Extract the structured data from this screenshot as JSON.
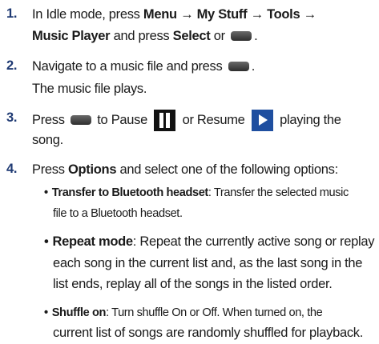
{
  "step1": {
    "number": "1.",
    "text_a": "In Idle mode, press ",
    "menu": "Menu",
    "arrow1": " → ",
    "my_stuff": "My Stuff",
    "arrow2": " → ",
    "tools": "Tools",
    "arrow3": " →",
    "music_player": "Music Player",
    "text_b": " and press ",
    "select": "Select",
    "text_c": " or ",
    "text_d": "."
  },
  "step2": {
    "number": "2.",
    "text_a": "Navigate to a music file and press ",
    "text_b": ".",
    "result": "The music file plays."
  },
  "step3": {
    "number": "3.",
    "press": "Press ",
    "to_pause": " to Pause ",
    "or_resume": " or Resume ",
    "playing": " playing the",
    "song": "song."
  },
  "step4": {
    "number": "4.",
    "press": "Press ",
    "options": "Options",
    "rest": " and select one of the following options:",
    "bullets": [
      {
        "term": "Transfer to Bluetooth headset",
        "lines": [
          ": Transfer the selected music",
          "file to a Bluetooth headset."
        ]
      },
      {
        "term": "Repeat mode",
        "lines": [
          ": Repeat the currently active song or replay",
          "each song in the current list and, as the last song in the",
          "list ends, replay all of the songs in the listed order."
        ]
      },
      {
        "term": "Shuffle on",
        "lines": [
          ": Turn shuffle On or Off. When turned on, the",
          "current list of songs are randomly shuffled for playback."
        ]
      }
    ]
  },
  "icons": {
    "key_color": "#3a3a3a",
    "pause_color": "#121212",
    "play_color": "#1f4fa0",
    "number_color": "#1f3a73"
  }
}
